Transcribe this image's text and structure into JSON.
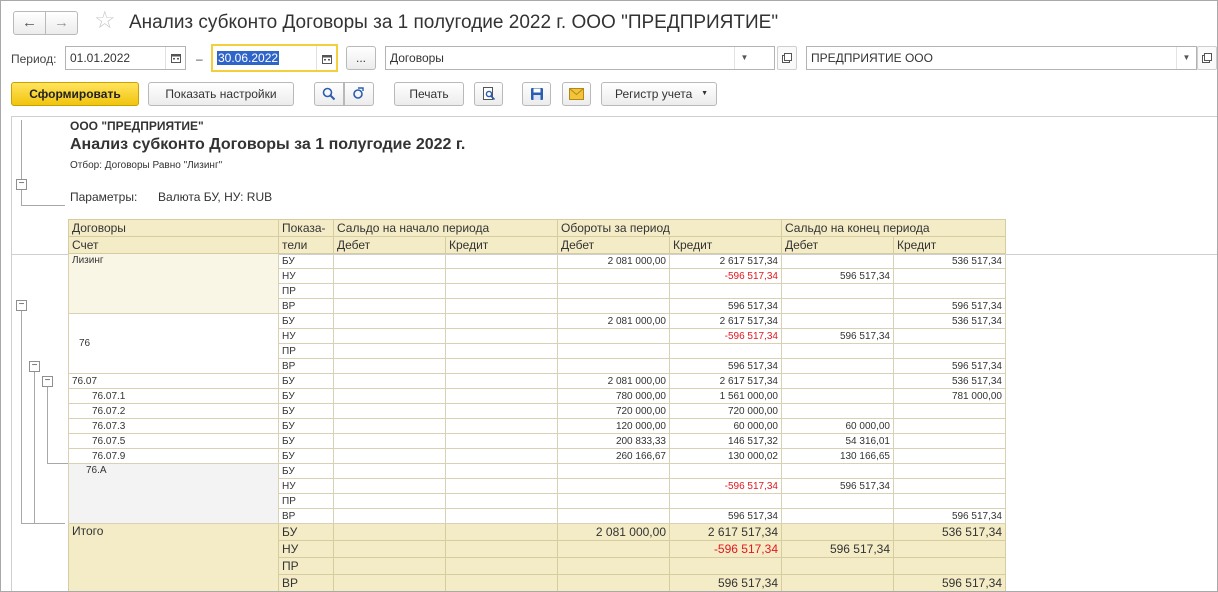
{
  "title": "Анализ субконто Договоры за 1 полугодие 2022 г. ООО \"ПРЕДПРИЯТИЕ\"",
  "nav": {
    "back": "←",
    "forward": "→",
    "star": "☆"
  },
  "filter": {
    "period_label": "Период:",
    "date_from": "01.01.2022",
    "dash": "–",
    "date_to": "30.06.2022",
    "ellipsis": "...",
    "subconto": "Договоры",
    "org": "ПРЕДПРИЯТИЕ ООО"
  },
  "toolbar": {
    "generate": "Сформировать",
    "settings": "Показать настройки",
    "print": "Печать",
    "register": "Регистр учета"
  },
  "report": {
    "org": "ООО \"ПРЕДПРИЯТИЕ\"",
    "title": "Анализ субконто Договоры за 1 полугодие 2022 г.",
    "filter": "Отбор: Договоры Равно \"Лизинг\"",
    "params_key": "Параметры:",
    "params_value": "Валюта БУ, НУ: RUB",
    "headers": {
      "contracts": "Договоры",
      "account": "Счет",
      "indicators": "Показа-",
      "indicators2": "тели",
      "opening": "Сальдо на начало периода",
      "turnover": "Обороты за период",
      "closing": "Сальдо на конец периода",
      "debit": "Дебет",
      "credit": "Кредит"
    },
    "groups": [
      {
        "name": "Лизинг",
        "rows": [
          {
            "ind": "БУ",
            "od": "",
            "oc": "",
            "td": "2 081 000,00",
            "tc": "2 617 517,34",
            "cd": "",
            "cc": "536 517,34"
          },
          {
            "ind": "НУ",
            "od": "",
            "oc": "",
            "td": "",
            "tc": "-596 517,34",
            "cd": "596 517,34",
            "cc": ""
          },
          {
            "ind": "ПР",
            "od": "",
            "oc": "",
            "td": "",
            "tc": "",
            "cd": "",
            "cc": ""
          },
          {
            "ind": "ВР",
            "od": "",
            "oc": "",
            "td": "",
            "tc": "596 517,34",
            "cd": "",
            "cc": "596 517,34"
          }
        ]
      },
      {
        "name": "76",
        "rows": [
          {
            "ind": "БУ",
            "od": "",
            "oc": "",
            "td": "2 081 000,00",
            "tc": "2 617 517,34",
            "cd": "",
            "cc": "536 517,34"
          },
          {
            "ind": "НУ",
            "od": "",
            "oc": "",
            "td": "",
            "tc": "-596 517,34",
            "cd": "596 517,34",
            "cc": ""
          },
          {
            "ind": "ПР",
            "od": "",
            "oc": "",
            "td": "",
            "tc": "",
            "cd": "",
            "cc": ""
          },
          {
            "ind": "ВР",
            "od": "",
            "oc": "",
            "td": "",
            "tc": "596 517,34",
            "cd": "",
            "cc": "596 517,34"
          }
        ]
      }
    ],
    "subaccounts": [
      {
        "name": "76.07",
        "ind": "БУ",
        "od": "",
        "oc": "",
        "td": "2 081 000,00",
        "tc": "2 617 517,34",
        "cd": "",
        "cc": "536 517,34"
      },
      {
        "name": "76.07.1",
        "ind": "БУ",
        "od": "",
        "oc": "",
        "td": "780 000,00",
        "tc": "1 561 000,00",
        "cd": "",
        "cc": "781 000,00"
      },
      {
        "name": "76.07.2",
        "ind": "БУ",
        "od": "",
        "oc": "",
        "td": "720 000,00",
        "tc": "720 000,00",
        "cd": "",
        "cc": ""
      },
      {
        "name": "76.07.3",
        "ind": "БУ",
        "od": "",
        "oc": "",
        "td": "120 000,00",
        "tc": "60 000,00",
        "cd": "60 000,00",
        "cc": ""
      },
      {
        "name": "76.07.5",
        "ind": "БУ",
        "od": "",
        "oc": "",
        "td": "200 833,33",
        "tc": "146 517,32",
        "cd": "54 316,01",
        "cc": ""
      },
      {
        "name": "76.07.9",
        "ind": "БУ",
        "od": "",
        "oc": "",
        "td": "260 166,67",
        "tc": "130 000,02",
        "cd": "130 166,65",
        "cc": ""
      }
    ],
    "group_76a": {
      "name": "76.А",
      "rows": [
        {
          "ind": "БУ",
          "od": "",
          "oc": "",
          "td": "",
          "tc": "",
          "cd": "",
          "cc": ""
        },
        {
          "ind": "НУ",
          "od": "",
          "oc": "",
          "td": "",
          "tc": "-596 517,34",
          "cd": "596 517,34",
          "cc": ""
        },
        {
          "ind": "ПР",
          "od": "",
          "oc": "",
          "td": "",
          "tc": "",
          "cd": "",
          "cc": ""
        },
        {
          "ind": "ВР",
          "od": "",
          "oc": "",
          "td": "",
          "tc": "596 517,34",
          "cd": "",
          "cc": "596 517,34"
        }
      ]
    },
    "total": {
      "name": "Итого",
      "rows": [
        {
          "ind": "БУ",
          "od": "",
          "oc": "",
          "td": "2 081 000,00",
          "tc": "2 617 517,34",
          "cd": "",
          "cc": "536 517,34"
        },
        {
          "ind": "НУ",
          "od": "",
          "oc": "",
          "td": "",
          "tc": "-596 517,34",
          "cd": "596 517,34",
          "cc": ""
        },
        {
          "ind": "ПР",
          "od": "",
          "oc": "",
          "td": "",
          "tc": "",
          "cd": "",
          "cc": ""
        },
        {
          "ind": "ВР",
          "od": "",
          "oc": "",
          "td": "",
          "tc": "596 517,34",
          "cd": "",
          "cc": "596 517,34"
        }
      ]
    },
    "collapse_glyph": "−"
  },
  "colors": {
    "accent_yellow": "#f1c40e",
    "negative": "#e0191f",
    "header_bg": "#f4ecc7"
  }
}
